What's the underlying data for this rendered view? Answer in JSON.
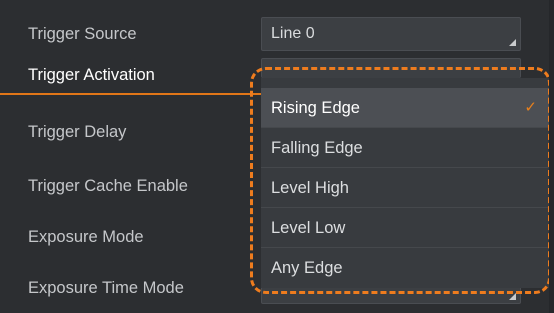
{
  "params": [
    {
      "label": "Trigger Source",
      "value": "Line 0"
    },
    {
      "label": "Trigger Activation",
      "value": ""
    },
    {
      "label": "Trigger Delay",
      "value": ""
    },
    {
      "label": "Trigger Cache Enable",
      "value": ""
    },
    {
      "label": "Exposure Mode",
      "value": ""
    },
    {
      "label": "Exposure Time Mode",
      "value": ""
    }
  ],
  "dropdown": {
    "options": [
      "Rising Edge",
      "Falling Edge",
      "Level High",
      "Level Low",
      "Any Edge"
    ],
    "selected": "Rising Edge",
    "check_glyph": "✓"
  },
  "colors": {
    "accent": "#e8801c",
    "highlight": "#ee7c1e",
    "background": "#2c2e31"
  }
}
